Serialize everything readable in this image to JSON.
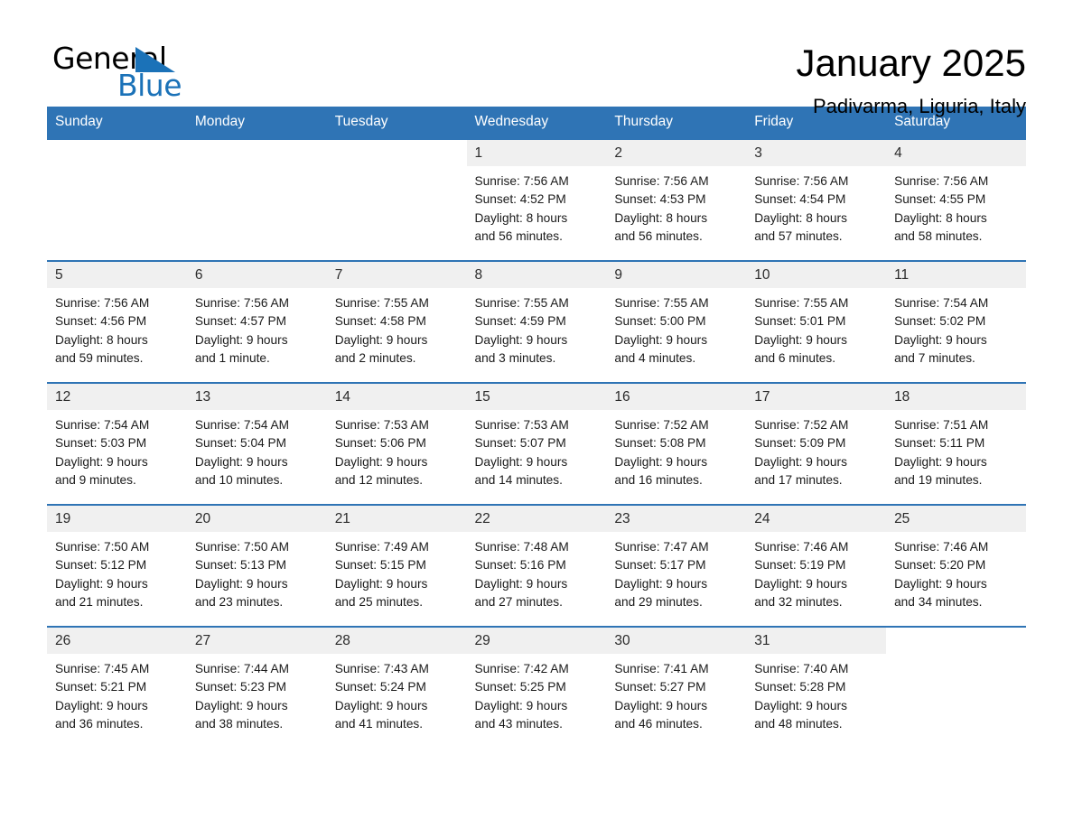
{
  "brand": {
    "name_part1": "General",
    "name_part2": "Blue",
    "logo_icon": "triangle-logo-icon",
    "accent_color": "#1b72b8"
  },
  "header": {
    "title": "January 2025",
    "location": "Padivarma, Liguria, Italy"
  },
  "theme": {
    "header_blue": "#2f74b5",
    "daynum_gray": "#f0f0f0",
    "text_color": "#1a1a1a"
  },
  "calendar": {
    "weekday_headers": [
      "Sunday",
      "Monday",
      "Tuesday",
      "Wednesday",
      "Thursday",
      "Friday",
      "Saturday"
    ],
    "weeks": [
      [
        {
          "day": "",
          "blank": true
        },
        {
          "day": "",
          "blank": true
        },
        {
          "day": "",
          "blank": true
        },
        {
          "day": "1",
          "sunrise": "Sunrise: 7:56 AM",
          "sunset": "Sunset: 4:52 PM",
          "daylight1": "Daylight: 8 hours",
          "daylight2": "and 56 minutes."
        },
        {
          "day": "2",
          "sunrise": "Sunrise: 7:56 AM",
          "sunset": "Sunset: 4:53 PM",
          "daylight1": "Daylight: 8 hours",
          "daylight2": "and 56 minutes."
        },
        {
          "day": "3",
          "sunrise": "Sunrise: 7:56 AM",
          "sunset": "Sunset: 4:54 PM",
          "daylight1": "Daylight: 8 hours",
          "daylight2": "and 57 minutes."
        },
        {
          "day": "4",
          "sunrise": "Sunrise: 7:56 AM",
          "sunset": "Sunset: 4:55 PM",
          "daylight1": "Daylight: 8 hours",
          "daylight2": "and 58 minutes."
        }
      ],
      [
        {
          "day": "5",
          "sunrise": "Sunrise: 7:56 AM",
          "sunset": "Sunset: 4:56 PM",
          "daylight1": "Daylight: 8 hours",
          "daylight2": "and 59 minutes."
        },
        {
          "day": "6",
          "sunrise": "Sunrise: 7:56 AM",
          "sunset": "Sunset: 4:57 PM",
          "daylight1": "Daylight: 9 hours",
          "daylight2": "and 1 minute."
        },
        {
          "day": "7",
          "sunrise": "Sunrise: 7:55 AM",
          "sunset": "Sunset: 4:58 PM",
          "daylight1": "Daylight: 9 hours",
          "daylight2": "and 2 minutes."
        },
        {
          "day": "8",
          "sunrise": "Sunrise: 7:55 AM",
          "sunset": "Sunset: 4:59 PM",
          "daylight1": "Daylight: 9 hours",
          "daylight2": "and 3 minutes."
        },
        {
          "day": "9",
          "sunrise": "Sunrise: 7:55 AM",
          "sunset": "Sunset: 5:00 PM",
          "daylight1": "Daylight: 9 hours",
          "daylight2": "and 4 minutes."
        },
        {
          "day": "10",
          "sunrise": "Sunrise: 7:55 AM",
          "sunset": "Sunset: 5:01 PM",
          "daylight1": "Daylight: 9 hours",
          "daylight2": "and 6 minutes."
        },
        {
          "day": "11",
          "sunrise": "Sunrise: 7:54 AM",
          "sunset": "Sunset: 5:02 PM",
          "daylight1": "Daylight: 9 hours",
          "daylight2": "and 7 minutes."
        }
      ],
      [
        {
          "day": "12",
          "sunrise": "Sunrise: 7:54 AM",
          "sunset": "Sunset: 5:03 PM",
          "daylight1": "Daylight: 9 hours",
          "daylight2": "and 9 minutes."
        },
        {
          "day": "13",
          "sunrise": "Sunrise: 7:54 AM",
          "sunset": "Sunset: 5:04 PM",
          "daylight1": "Daylight: 9 hours",
          "daylight2": "and 10 minutes."
        },
        {
          "day": "14",
          "sunrise": "Sunrise: 7:53 AM",
          "sunset": "Sunset: 5:06 PM",
          "daylight1": "Daylight: 9 hours",
          "daylight2": "and 12 minutes."
        },
        {
          "day": "15",
          "sunrise": "Sunrise: 7:53 AM",
          "sunset": "Sunset: 5:07 PM",
          "daylight1": "Daylight: 9 hours",
          "daylight2": "and 14 minutes."
        },
        {
          "day": "16",
          "sunrise": "Sunrise: 7:52 AM",
          "sunset": "Sunset: 5:08 PM",
          "daylight1": "Daylight: 9 hours",
          "daylight2": "and 16 minutes."
        },
        {
          "day": "17",
          "sunrise": "Sunrise: 7:52 AM",
          "sunset": "Sunset: 5:09 PM",
          "daylight1": "Daylight: 9 hours",
          "daylight2": "and 17 minutes."
        },
        {
          "day": "18",
          "sunrise": "Sunrise: 7:51 AM",
          "sunset": "Sunset: 5:11 PM",
          "daylight1": "Daylight: 9 hours",
          "daylight2": "and 19 minutes."
        }
      ],
      [
        {
          "day": "19",
          "sunrise": "Sunrise: 7:50 AM",
          "sunset": "Sunset: 5:12 PM",
          "daylight1": "Daylight: 9 hours",
          "daylight2": "and 21 minutes."
        },
        {
          "day": "20",
          "sunrise": "Sunrise: 7:50 AM",
          "sunset": "Sunset: 5:13 PM",
          "daylight1": "Daylight: 9 hours",
          "daylight2": "and 23 minutes."
        },
        {
          "day": "21",
          "sunrise": "Sunrise: 7:49 AM",
          "sunset": "Sunset: 5:15 PM",
          "daylight1": "Daylight: 9 hours",
          "daylight2": "and 25 minutes."
        },
        {
          "day": "22",
          "sunrise": "Sunrise: 7:48 AM",
          "sunset": "Sunset: 5:16 PM",
          "daylight1": "Daylight: 9 hours",
          "daylight2": "and 27 minutes."
        },
        {
          "day": "23",
          "sunrise": "Sunrise: 7:47 AM",
          "sunset": "Sunset: 5:17 PM",
          "daylight1": "Daylight: 9 hours",
          "daylight2": "and 29 minutes."
        },
        {
          "day": "24",
          "sunrise": "Sunrise: 7:46 AM",
          "sunset": "Sunset: 5:19 PM",
          "daylight1": "Daylight: 9 hours",
          "daylight2": "and 32 minutes."
        },
        {
          "day": "25",
          "sunrise": "Sunrise: 7:46 AM",
          "sunset": "Sunset: 5:20 PM",
          "daylight1": "Daylight: 9 hours",
          "daylight2": "and 34 minutes."
        }
      ],
      [
        {
          "day": "26",
          "sunrise": "Sunrise: 7:45 AM",
          "sunset": "Sunset: 5:21 PM",
          "daylight1": "Daylight: 9 hours",
          "daylight2": "and 36 minutes."
        },
        {
          "day": "27",
          "sunrise": "Sunrise: 7:44 AM",
          "sunset": "Sunset: 5:23 PM",
          "daylight1": "Daylight: 9 hours",
          "daylight2": "and 38 minutes."
        },
        {
          "day": "28",
          "sunrise": "Sunrise: 7:43 AM",
          "sunset": "Sunset: 5:24 PM",
          "daylight1": "Daylight: 9 hours",
          "daylight2": "and 41 minutes."
        },
        {
          "day": "29",
          "sunrise": "Sunrise: 7:42 AM",
          "sunset": "Sunset: 5:25 PM",
          "daylight1": "Daylight: 9 hours",
          "daylight2": "and 43 minutes."
        },
        {
          "day": "30",
          "sunrise": "Sunrise: 7:41 AM",
          "sunset": "Sunset: 5:27 PM",
          "daylight1": "Daylight: 9 hours",
          "daylight2": "and 46 minutes."
        },
        {
          "day": "31",
          "sunrise": "Sunrise: 7:40 AM",
          "sunset": "Sunset: 5:28 PM",
          "daylight1": "Daylight: 9 hours",
          "daylight2": "and 48 minutes."
        },
        {
          "day": "",
          "blank": true
        }
      ]
    ]
  }
}
